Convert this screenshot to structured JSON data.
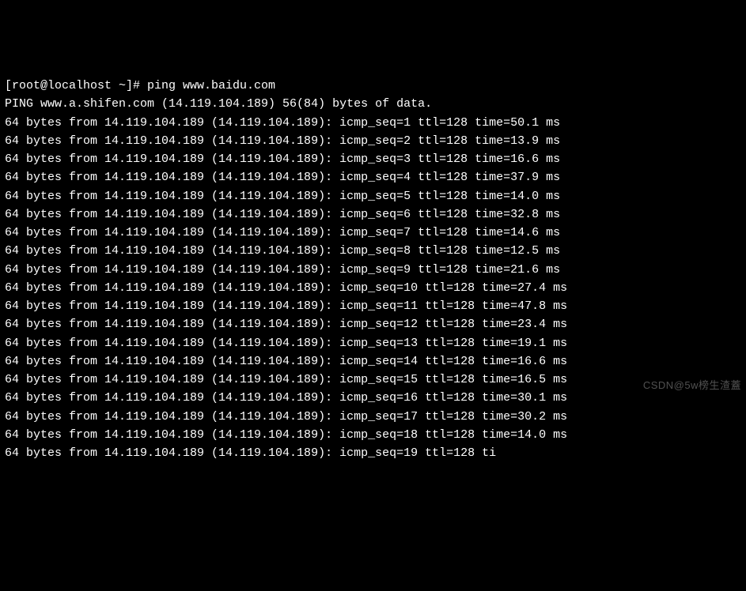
{
  "prompt": {
    "user_host": "[root@localhost ~]#",
    "command": "ping www.baidu.com"
  },
  "header": {
    "text": "PING www.a.shifen.com (14.119.104.189) 56(84) bytes of data."
  },
  "replies": [
    {
      "bytes": "64",
      "from_ip": "14.119.104.189",
      "paren_ip": "14.119.104.189",
      "seq": "1",
      "ttl": "128",
      "time": "50.1"
    },
    {
      "bytes": "64",
      "from_ip": "14.119.104.189",
      "paren_ip": "14.119.104.189",
      "seq": "2",
      "ttl": "128",
      "time": "13.9"
    },
    {
      "bytes": "64",
      "from_ip": "14.119.104.189",
      "paren_ip": "14.119.104.189",
      "seq": "3",
      "ttl": "128",
      "time": "16.6"
    },
    {
      "bytes": "64",
      "from_ip": "14.119.104.189",
      "paren_ip": "14.119.104.189",
      "seq": "4",
      "ttl": "128",
      "time": "37.9"
    },
    {
      "bytes": "64",
      "from_ip": "14.119.104.189",
      "paren_ip": "14.119.104.189",
      "seq": "5",
      "ttl": "128",
      "time": "14.0"
    },
    {
      "bytes": "64",
      "from_ip": "14.119.104.189",
      "paren_ip": "14.119.104.189",
      "seq": "6",
      "ttl": "128",
      "time": "32.8"
    },
    {
      "bytes": "64",
      "from_ip": "14.119.104.189",
      "paren_ip": "14.119.104.189",
      "seq": "7",
      "ttl": "128",
      "time": "14.6"
    },
    {
      "bytes": "64",
      "from_ip": "14.119.104.189",
      "paren_ip": "14.119.104.189",
      "seq": "8",
      "ttl": "128",
      "time": "12.5"
    },
    {
      "bytes": "64",
      "from_ip": "14.119.104.189",
      "paren_ip": "14.119.104.189",
      "seq": "9",
      "ttl": "128",
      "time": "21.6"
    },
    {
      "bytes": "64",
      "from_ip": "14.119.104.189",
      "paren_ip": "14.119.104.189",
      "seq": "10",
      "ttl": "128",
      "time": "27.4"
    },
    {
      "bytes": "64",
      "from_ip": "14.119.104.189",
      "paren_ip": "14.119.104.189",
      "seq": "11",
      "ttl": "128",
      "time": "47.8"
    },
    {
      "bytes": "64",
      "from_ip": "14.119.104.189",
      "paren_ip": "14.119.104.189",
      "seq": "12",
      "ttl": "128",
      "time": "23.4"
    },
    {
      "bytes": "64",
      "from_ip": "14.119.104.189",
      "paren_ip": "14.119.104.189",
      "seq": "13",
      "ttl": "128",
      "time": "19.1"
    },
    {
      "bytes": "64",
      "from_ip": "14.119.104.189",
      "paren_ip": "14.119.104.189",
      "seq": "14",
      "ttl": "128",
      "time": "16.6"
    },
    {
      "bytes": "64",
      "from_ip": "14.119.104.189",
      "paren_ip": "14.119.104.189",
      "seq": "15",
      "ttl": "128",
      "time": "16.5"
    },
    {
      "bytes": "64",
      "from_ip": "14.119.104.189",
      "paren_ip": "14.119.104.189",
      "seq": "16",
      "ttl": "128",
      "time": "30.1"
    },
    {
      "bytes": "64",
      "from_ip": "14.119.104.189",
      "paren_ip": "14.119.104.189",
      "seq": "17",
      "ttl": "128",
      "time": "30.2"
    },
    {
      "bytes": "64",
      "from_ip": "14.119.104.189",
      "paren_ip": "14.119.104.189",
      "seq": "18",
      "ttl": "128",
      "time": "14.0"
    },
    {
      "bytes": "64",
      "from_ip": "14.119.104.189",
      "paren_ip": "14.119.104.189",
      "seq": "19",
      "ttl": "128",
      "time_trunc": "ti"
    }
  ],
  "watermark": "CSDN@5w榜生渣蓋"
}
